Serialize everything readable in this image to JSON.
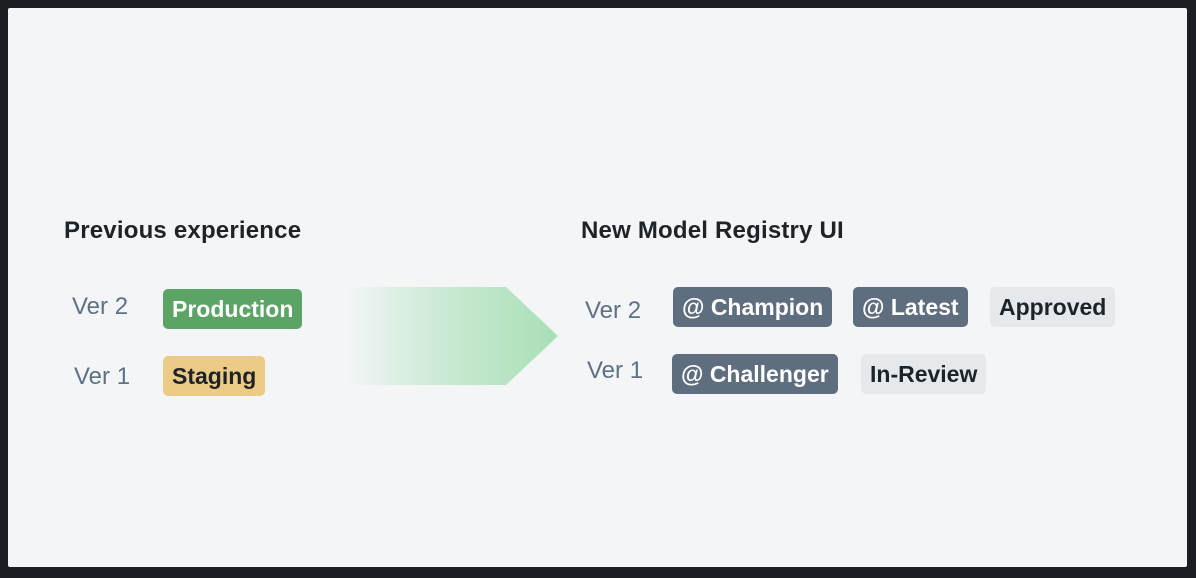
{
  "previous": {
    "title": "Previous experience",
    "rows": [
      {
        "version": "Ver 2",
        "stage": "Production"
      },
      {
        "version": "Ver 1",
        "stage": "Staging"
      }
    ]
  },
  "new_ui": {
    "title": "New Model Registry UI",
    "rows": [
      {
        "version": "Ver 2",
        "aliases": [
          "@ Champion",
          "@ Latest"
        ],
        "tags": [
          "Approved"
        ]
      },
      {
        "version": "Ver 1",
        "aliases": [
          "@ Challenger"
        ],
        "tags": [
          "In-Review"
        ]
      }
    ]
  },
  "colors": {
    "background": "#f3f5f7",
    "production": "#5ba466",
    "staging": "#ebcb86",
    "alias": "#5e6e7f",
    "tag": "#e6e9ec",
    "arrow": "#a8dfb6",
    "version_text": "#5f7184"
  },
  "icons": {
    "transition_arrow": "arrow-right-icon"
  }
}
